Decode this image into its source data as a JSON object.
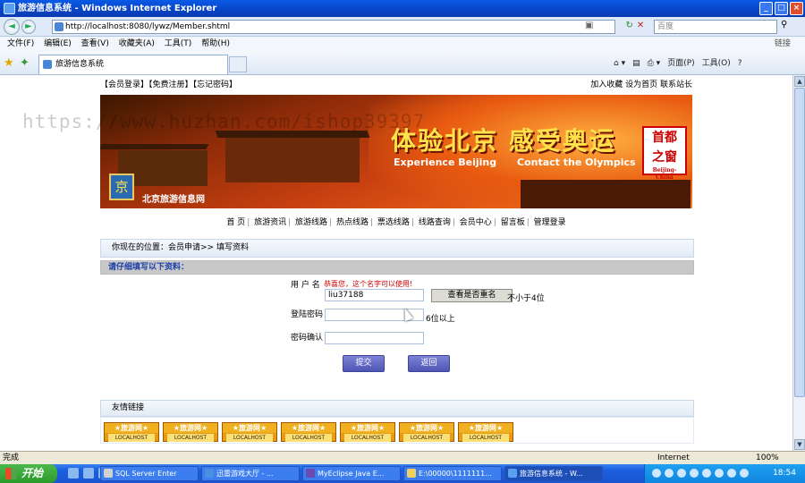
{
  "window": {
    "title": "旅游信息系统 - Windows Internet Explorer"
  },
  "address": {
    "url": "http://localhost:8080/lywz/Member.shtml",
    "search_placeholder": "百度"
  },
  "menu": {
    "items": [
      "文件(F)",
      "编辑(E)",
      "查看(V)",
      "收藏夹(A)",
      "工具(T)",
      "帮助(H)"
    ],
    "links": "链接"
  },
  "tab": {
    "title": "旅游信息系统"
  },
  "commandbar": {
    "page": "页面(P)",
    "tools": "工具(O)"
  },
  "watermark": "https://www.huzhan.com/ishop39397",
  "top_links": {
    "left": "【会员登录】【免费注册】【忘记密码】",
    "right": "加入收藏 设为首页 联系站长"
  },
  "banner": {
    "title": "体验北京 感受奥运",
    "en1": "Experience Beijing",
    "en2": "Contact the Olympics",
    "site_name": "北京旅游信息网",
    "seal_top": "首都",
    "seal_mid": "之窗",
    "seal_sub": "Beijing-China"
  },
  "nav": {
    "items": [
      "首 页",
      "旅游资讯",
      "旅游线路",
      "热点线路",
      "票选线路",
      "线路查询",
      "会员中心",
      "留言板",
      "管理登录"
    ]
  },
  "breadcrumb": "你现在的位置：会员申请>> 填写资料",
  "form": {
    "header": "请仔细填写以下资料：",
    "username_label": "用 户 名",
    "username_hint": "恭喜您，这个名字可以使用!",
    "username_value": "liu37188",
    "check_button": "查看是否重名",
    "username_rule": "不小于4位",
    "password_label": "登陆密码",
    "password_rule": "6位以上",
    "confirm_label": "密码确认",
    "submit": "提交",
    "back": "返回"
  },
  "friends": {
    "header": "友情链接",
    "link_top": "★旅游网★",
    "link_bottom": "LOCALHOST",
    "count": 7
  },
  "status": {
    "left": "完成",
    "zone": "Internet",
    "zoom": "100%"
  },
  "taskbar": {
    "start": "开始",
    "items": [
      "SQL Server Enter",
      "迅雷游戏大厅 - ...",
      "MyEclipse Java E...",
      "E:\\00000\\1111111...",
      "旅游信息系统 - W..."
    ],
    "clock": "18:54"
  }
}
